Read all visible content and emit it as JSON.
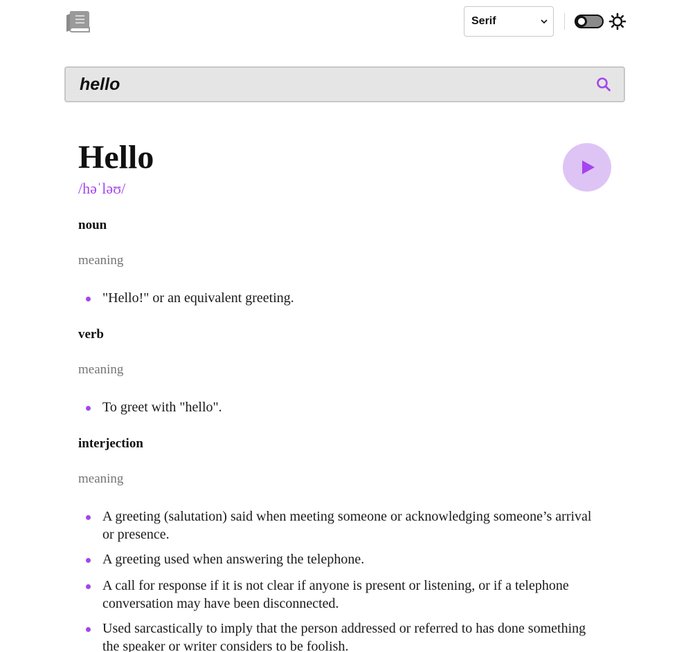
{
  "header": {
    "font_select": {
      "value": "Serif"
    }
  },
  "search": {
    "value": "hello"
  },
  "entry": {
    "word": "Hello",
    "phonetic": "/həˈləʊ/",
    "meanings": [
      {
        "part_of_speech": "noun",
        "label": "meaning",
        "definitions": [
          "\"Hello!\" or an equivalent greeting."
        ]
      },
      {
        "part_of_speech": "verb",
        "label": "meaning",
        "definitions": [
          "To greet with \"hello\"."
        ]
      },
      {
        "part_of_speech": "interjection",
        "label": "meaning",
        "definitions": [
          "A greeting (salutation) said when meeting someone or acknowledging someone’s arrival or presence.",
          "A greeting used when answering the telephone.",
          "A call for response if it is not clear if anyone is present or listening, or if a telephone conversation may have been disconnected.",
          "Used sarcastically to imply that the person addressed or referred to has done something the speaker or writer considers to be foolish."
        ]
      }
    ]
  },
  "colors": {
    "accent": "#a445ed",
    "play_bg": "#dec4f5",
    "search_bg": "#e5e5e5",
    "muted": "#757575"
  },
  "icons": {
    "logo": "book-icon",
    "font_chevron": "chevron-down-icon",
    "theme": "sun-icon",
    "search": "search-icon",
    "play": "play-icon"
  }
}
